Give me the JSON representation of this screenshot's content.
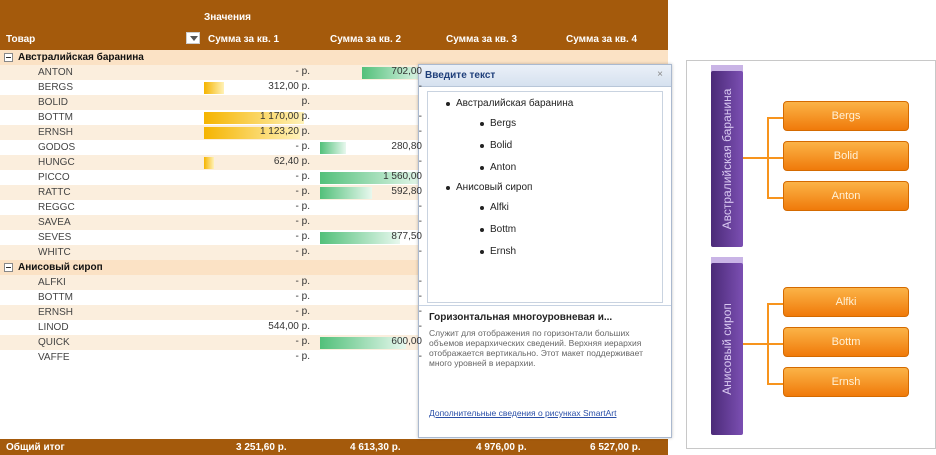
{
  "pivot": {
    "values_label": "Значения",
    "row_header": "Товар",
    "columns": [
      "Сумма за кв. 1",
      "Сумма за кв. 2",
      "Сумма за кв. 3",
      "Сумма за кв. 4"
    ],
    "groups": [
      {
        "name": "Австралийская баранина",
        "rows": [
          {
            "name": "ANTON",
            "q1": "- р.",
            "q2": "702,00"
          },
          {
            "name": "BERGS",
            "q1": "312,00 р.",
            "q2": "-"
          },
          {
            "name": "BOLID",
            "q1": "р.",
            "q2": ""
          },
          {
            "name": "BOTTM",
            "q1": "1 170,00 р.",
            "q2": "-"
          },
          {
            "name": "ERNSH",
            "q1": "1 123,20 р.",
            "q2": "-"
          },
          {
            "name": "GODOS",
            "q1": "- р.",
            "q2": "280,80"
          },
          {
            "name": "HUNGC",
            "q1": "62,40 р.",
            "q2": "-"
          },
          {
            "name": "PICCO",
            "q1": "- р.",
            "q2": "1 560,00"
          },
          {
            "name": "RATTC",
            "q1": "- р.",
            "q2": "592,80"
          },
          {
            "name": "REGGC",
            "q1": "- р.",
            "q2": "-"
          },
          {
            "name": "SAVEA",
            "q1": "- р.",
            "q2": "-"
          },
          {
            "name": "SEVES",
            "q1": "- р.",
            "q2": "877,50"
          },
          {
            "name": "WHITC",
            "q1": "- р.",
            "q2": "-"
          }
        ]
      },
      {
        "name": "Анисовый сироп",
        "rows": [
          {
            "name": "ALFKI",
            "q1": "- р.",
            "q2": "-"
          },
          {
            "name": "BOTTM",
            "q1": "- р.",
            "q2": "-"
          },
          {
            "name": "ERNSH",
            "q1": "- р.",
            "q2": "-"
          },
          {
            "name": "LINOD",
            "q1": "544,00 р.",
            "q2": "-"
          },
          {
            "name": "QUICK",
            "q1": "- р.",
            "q2": "600,00"
          },
          {
            "name": "VAFFE",
            "q1": "- р.",
            "q2": "-"
          }
        ]
      }
    ],
    "total_label": "Общий итог",
    "totals": [
      "3 251,60 р.",
      "4 613,30 р.",
      "4 976,00 р.",
      "6 527,00 р."
    ]
  },
  "text_pane": {
    "title": "Введите текст",
    "close": "×",
    "items": [
      {
        "level": 1,
        "text": "Австралийская баранина"
      },
      {
        "level": 2,
        "text": "Bergs"
      },
      {
        "level": 2,
        "text": "Bolid"
      },
      {
        "level": 2,
        "text": "Anton"
      },
      {
        "level": 1,
        "text": "Анисовый сироп"
      },
      {
        "level": 2,
        "text": "Alfki"
      },
      {
        "level": 2,
        "text": "Bottm"
      },
      {
        "level": 2,
        "text": "Ernsh"
      }
    ],
    "desc_title": "Горизонтальная многоуровневая и...",
    "desc_text": "Служит для отображения по горизонтали больших объемов иерархических сведений. Верхняя иерархия отображается вертикально. Этот макет поддерживает много уровней в иерархии.",
    "desc_link": "Дополнительные сведения о рисунках SmartArt"
  },
  "smartart": {
    "group1": "Австралийская баранина",
    "group1_items": [
      "Bergs",
      "Bolid",
      "Anton"
    ],
    "group2": "Анисовый сироп",
    "group2_items": [
      "Alfki",
      "Bottm",
      "Ernsh"
    ]
  },
  "colors": {
    "pivot_header": "#a45a0c",
    "databar_yellow": "#f5b400",
    "databar_green": "#52c07a",
    "smartart_purple": "#5c3a8f",
    "smartart_orange": "#f7941d"
  }
}
